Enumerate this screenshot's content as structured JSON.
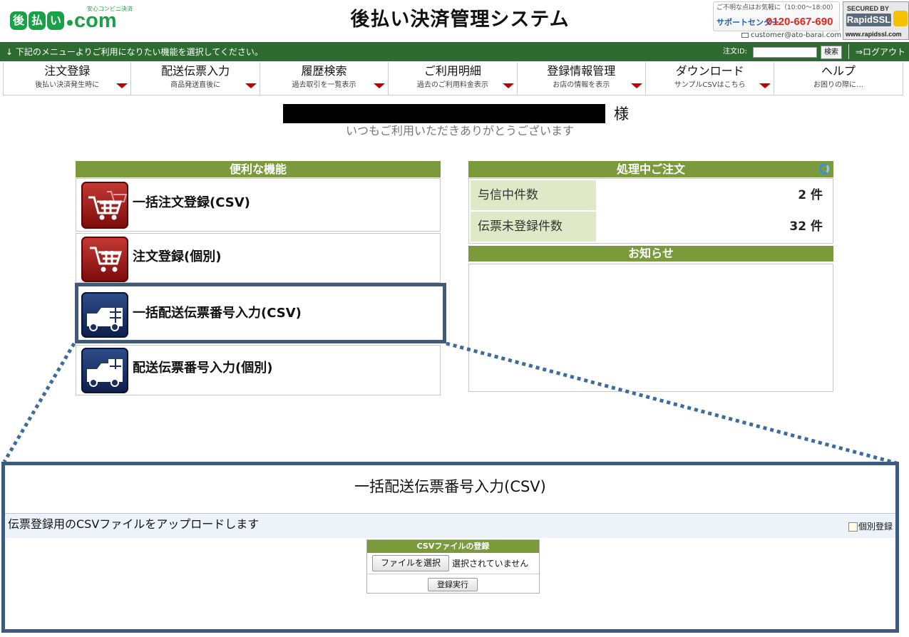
{
  "header": {
    "logo_jp": [
      "後",
      "払",
      "い"
    ],
    "logo_com": "com",
    "logo_tagline": "安心コンビニ決済",
    "title": "後払い決済管理システム",
    "support_hours": "ご不明な点はお気軽に（10:00〜18:00）",
    "support_label": "サポートセンター",
    "support_phone": "0120-667-690",
    "support_email": "customer@ato-barai.com",
    "ssl_top": "SECURED BY",
    "ssl_brand": "RapidSSL",
    "ssl_url": "www.rapidssl.com"
  },
  "toolbar": {
    "message": "↓ 下記のメニューよりご利用になりたい機能を選択してください。",
    "order_id_label": "注文ID:",
    "order_id_value": "",
    "search_label": "検索",
    "logout_label": "⇒ログアウト"
  },
  "nav": [
    {
      "title": "注文登録",
      "sub": "後払い決済発生時に"
    },
    {
      "title": "配送伝票入力",
      "sub": "商品発送直後に"
    },
    {
      "title": "履歴検索",
      "sub": "過去取引を一覧表示"
    },
    {
      "title": "ご利用明細",
      "sub": "過去のご利用料金表示"
    },
    {
      "title": "登録情報管理",
      "sub": "お店の情報を表示"
    },
    {
      "title": "ダウンロード",
      "sub": "サンプルCSVはこちら"
    },
    {
      "title": "ヘルプ",
      "sub": "お困りの際に…"
    }
  ],
  "greeting": {
    "honorific": "様",
    "thanks": "いつもご利用いただきありがとうございます"
  },
  "features": {
    "title": "便利な機能",
    "items": [
      {
        "label": "一括注文登録(CSV)",
        "icon": "cart-icon"
      },
      {
        "label": "注文登録(個別)",
        "icon": "cart-icon"
      },
      {
        "label": "一括配送伝票番号入力(CSV)",
        "icon": "truck-icon"
      },
      {
        "label": "配送伝票番号入力(個別)",
        "icon": "truck-icon"
      }
    ]
  },
  "processing": {
    "title": "処理中ご注文",
    "rows": [
      {
        "label": "与信中件数",
        "value": "2 件"
      },
      {
        "label": "伝票未登録件数",
        "value": "32 件"
      }
    ]
  },
  "notice": {
    "title": "お知らせ"
  },
  "zoom": {
    "title": "一括配送伝票番号入力(CSV)",
    "description": "伝票登録用のCSVファイルをアップロードします",
    "individual_link": "個別登録",
    "form_title": "CSVファイルの登録",
    "choose_file_label": "ファイルを選択",
    "no_file_text": "選択されていません",
    "submit_label": "登録実行"
  },
  "colors": {
    "header_green": "#2d6b31",
    "panel_green": "#7a9a3c",
    "highlight_navy": "#3d5b7e",
    "nav_arrow_red": "#c00000"
  }
}
